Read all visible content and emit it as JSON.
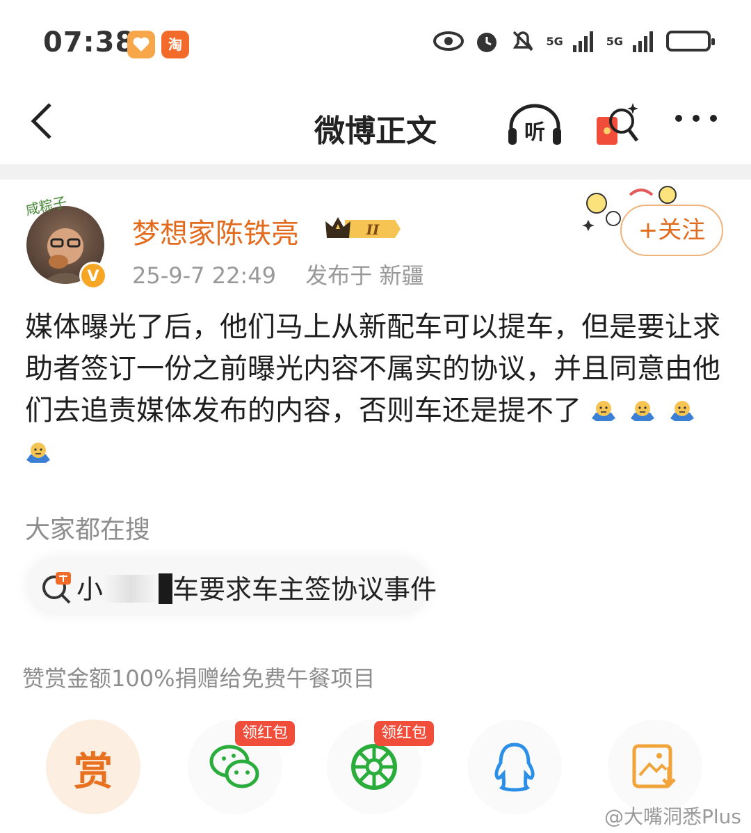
{
  "status_bar": {
    "time": "07:38",
    "taobao_badge": "淘",
    "signal_1": "5G",
    "signal_2": "5G"
  },
  "header": {
    "title": "微博正文",
    "listen_label": "听"
  },
  "post": {
    "author": "梦想家陈铁亮",
    "avatar_caption": "咸粽子",
    "verified_badge": "V",
    "level_badge": "II",
    "timestamp": "25-9-7 22:49",
    "location": "发布于 新疆",
    "follow_label": "+关注",
    "body": "媒体曝光了后，他们马上从新配车可以提车，但是要让求助者签订一份之前曝光内容不属实的协议，并且同意由他们去追责媒体发布的内容，否则车还是提不了"
  },
  "search": {
    "heading": "大家都在搜",
    "hot_prefix": "小",
    "hot_suffix": "车要求车主签协议事件",
    "hot_icon": "hot-search-icon"
  },
  "reward_note": "赞赏金额100%捐赠给免费午餐项目",
  "share": {
    "reward_label": "赏",
    "red_packet_label": "领红包",
    "items": [
      "wechat-icon",
      "moments-icon",
      "qq-icon",
      "save-image-icon"
    ]
  },
  "watermark": "@大嘴洞悉Plus",
  "colors": {
    "accent": "#e26b1d",
    "wechat": "#2bad3c",
    "qq": "#2b8fe8",
    "red": "#f04d3a"
  }
}
